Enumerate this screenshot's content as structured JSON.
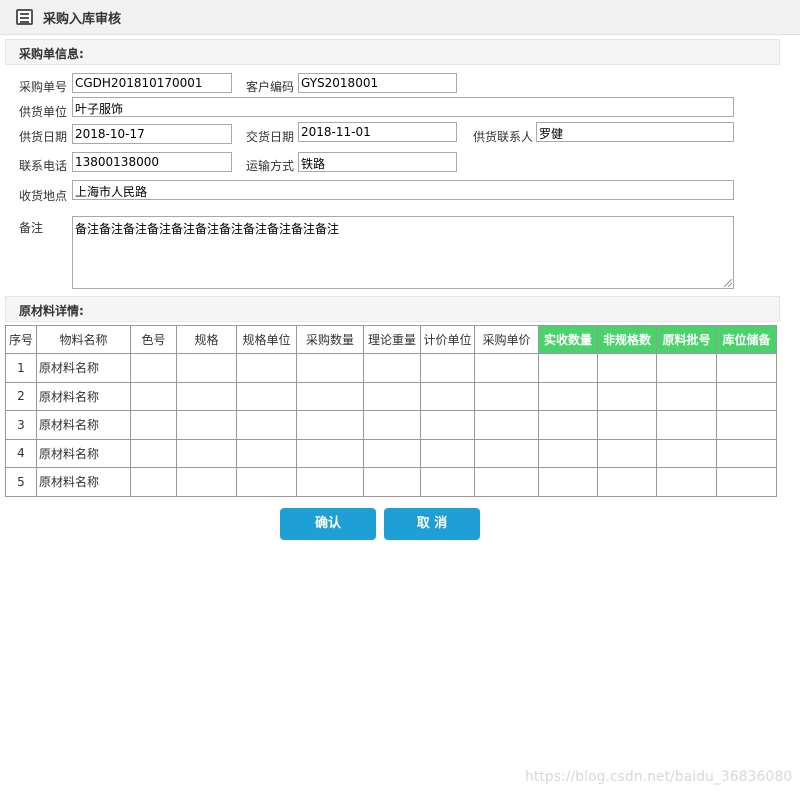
{
  "header": {
    "title": "采购入库审核",
    "icon": "list-icon"
  },
  "order_section": {
    "title": "采购单信息:"
  },
  "form": {
    "order_no": {
      "label": "采购单号",
      "value": "CGDH201810170001"
    },
    "customer_code": {
      "label": "客户编码",
      "value": "GYS2018001"
    },
    "supplier": {
      "label": "供货单位",
      "value": "叶子服饰"
    },
    "supply_date": {
      "label": "供货日期",
      "value": "2018-10-17"
    },
    "delivery_date": {
      "label": "交货日期",
      "value": "2018-11-01"
    },
    "contact": {
      "label": "供货联系人",
      "value": "罗健"
    },
    "phone": {
      "label": "联系电话",
      "value": "13800138000"
    },
    "transport": {
      "label": "运输方式",
      "value": "铁路"
    },
    "address": {
      "label": "收货地点",
      "value": "上海市人民路"
    },
    "remark": {
      "label": "备注",
      "value": "备注备注备注备注备注备注备注备注备注备注备注"
    }
  },
  "material_section": {
    "title": "原材料详情:"
  },
  "table": {
    "columns": [
      "序号",
      "物料名称",
      "色号",
      "规格",
      "规格单位",
      "采购数量",
      "理论重量",
      "计价单位",
      "采购单价",
      "实收数量",
      "非规格数",
      "原料批号",
      "库位储备"
    ],
    "rows": [
      {
        "no": "1",
        "name": "原材料名称"
      },
      {
        "no": "2",
        "name": "原材料名称"
      },
      {
        "no": "3",
        "name": "原材料名称"
      },
      {
        "no": "4",
        "name": "原材料名称"
      },
      {
        "no": "5",
        "name": "原材料名称"
      }
    ]
  },
  "buttons": {
    "confirm": "确认",
    "cancel": "取 消"
  },
  "watermark": "https://blog.csdn.net/baidu_36836080",
  "colors": {
    "accent_button": "#1e9fd6",
    "green_header": "#4cd26b"
  }
}
